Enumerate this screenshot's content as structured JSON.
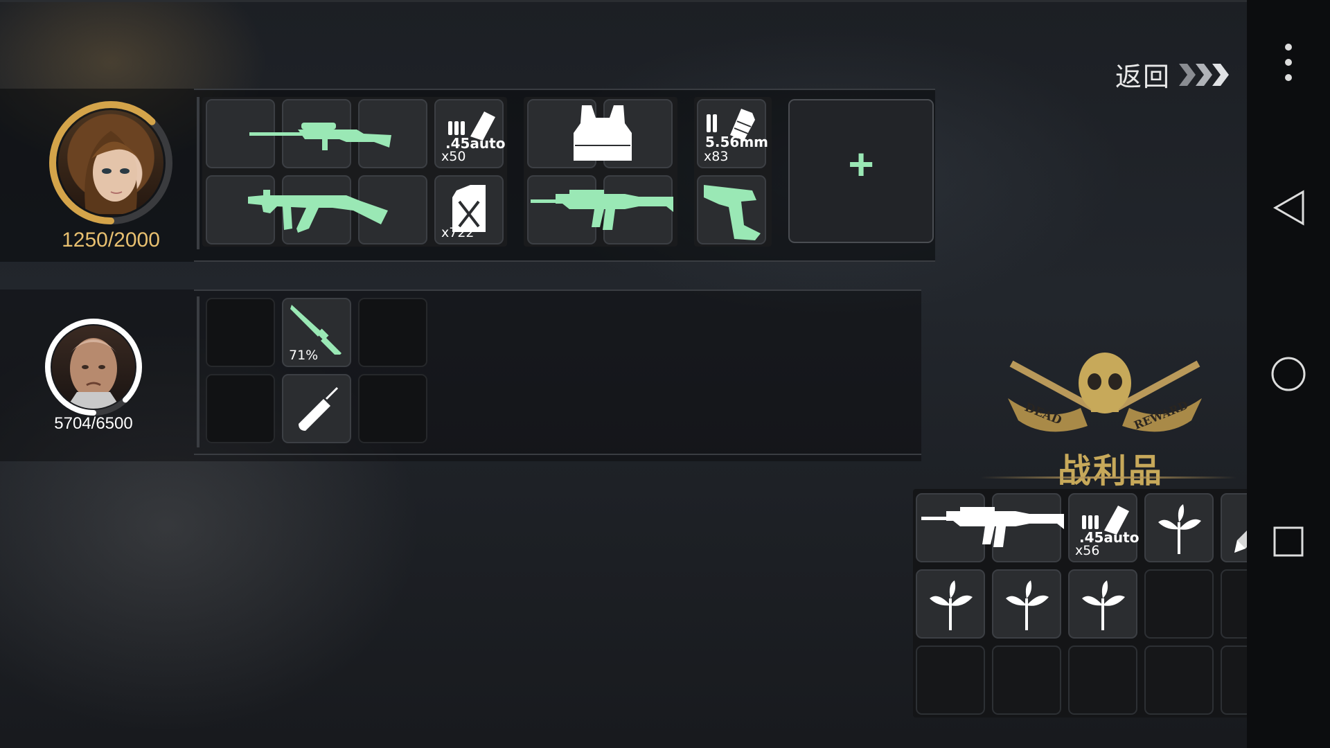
{
  "header": {
    "back_label": "返回"
  },
  "hero1": {
    "hp": "1250/2000",
    "hp_fraction": 0.625
  },
  "hero1_items": {
    "ammo45_caliber": ".45auto",
    "ammo45_count": "x50",
    "fuel_count": "x722",
    "ammo556_caliber": "5.56mm",
    "ammo556_count": "x83",
    "add_symbol": "+"
  },
  "hero2": {
    "hp": "5704/6500",
    "hp_fraction": 0.877
  },
  "hero2_items": {
    "knife_durability": "71%"
  },
  "loot": {
    "title": "战利品",
    "emblem_left": "DEAD",
    "emblem_right": "REWARD",
    "ammo_caliber": ".45auto",
    "ammo_count": "x56"
  },
  "colors": {
    "accent": "#9ae8b5",
    "gold": "#c7a95a",
    "hp_gold": "#e8c070",
    "white": "#ffffff"
  }
}
